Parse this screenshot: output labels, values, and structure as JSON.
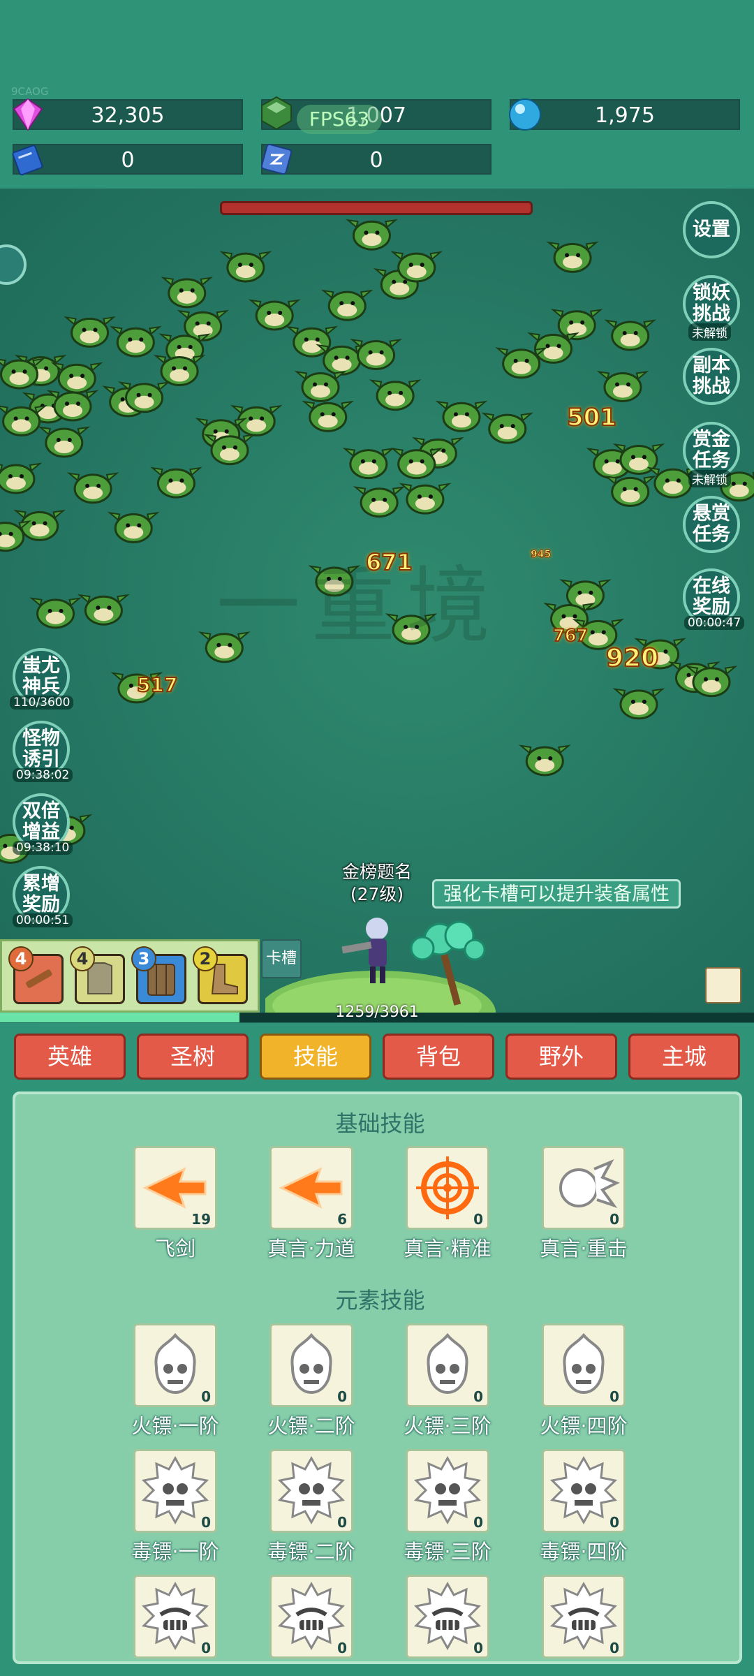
{
  "top": {
    "game_id": "9CAOG",
    "fps": "FPS63",
    "gems": "32,305",
    "green_crystal": "1,007",
    "blue_orb": "1,975",
    "book": "0",
    "rune": "0"
  },
  "battle": {
    "watermark": "一重境",
    "damage_numbers": [
      "501",
      "671",
      "517",
      "767",
      "920",
      "945"
    ],
    "hero_name": "金榜题名",
    "hero_level": "(27级)",
    "hint": "强化卡槽可以提升装备属性",
    "card_slot_label": "卡槽",
    "xp_text": "1259/3961",
    "xp_fraction": 0.318
  },
  "right_buttons": [
    {
      "label": "设置",
      "sub": ""
    },
    {
      "label": "锁妖挑战",
      "sub": "未解锁"
    },
    {
      "label": "副本挑战",
      "sub": ""
    },
    {
      "label": "赏金任务",
      "sub": "未解锁"
    },
    {
      "label": "悬赏任务",
      "sub": ""
    },
    {
      "label": "在线奖励",
      "sub": "00:00:47"
    }
  ],
  "left_buttons": [
    {
      "label": "蚩尤神兵",
      "sub": "110/3600"
    },
    {
      "label": "怪物诱引",
      "sub": "09:38:02"
    },
    {
      "label": "双倍增益",
      "sub": "09:38:10"
    },
    {
      "label": "累增奖励",
      "sub": "00:00:51"
    }
  ],
  "equipment": [
    {
      "num": "4",
      "item": "sword-icon"
    },
    {
      "num": "4",
      "item": "armor-icon"
    },
    {
      "num": "3",
      "item": "shield-icon"
    },
    {
      "num": "2",
      "item": "boots-icon"
    }
  ],
  "nav": [
    "英雄",
    "圣树",
    "技能",
    "背包",
    "野外",
    "主城"
  ],
  "nav_active": "技能",
  "basic_title": "基础技能",
  "basic_skills": [
    {
      "name": "飞剑",
      "count": "19"
    },
    {
      "name": "真言·力道",
      "count": "6"
    },
    {
      "name": "真言·精准",
      "count": "0"
    },
    {
      "name": "真言·重击",
      "count": "0"
    }
  ],
  "element_title": "元素技能",
  "fire_skills": [
    {
      "name": "火镖·一阶",
      "count": "0"
    },
    {
      "name": "火镖·二阶",
      "count": "0"
    },
    {
      "name": "火镖·三阶",
      "count": "0"
    },
    {
      "name": "火镖·四阶",
      "count": "0"
    }
  ],
  "poison_skills": [
    {
      "name": "毒镖·一阶",
      "count": "0"
    },
    {
      "name": "毒镖·二阶",
      "count": "0"
    },
    {
      "name": "毒镖·三阶",
      "count": "0"
    },
    {
      "name": "毒镖·四阶",
      "count": "0"
    }
  ],
  "grin_skills": [
    {
      "count": "0"
    },
    {
      "count": "0"
    },
    {
      "count": "0"
    },
    {
      "count": "0"
    }
  ],
  "colors": {
    "accent_active": "#f1b32a",
    "nav": "#e45a48",
    "panel": "#86ceaa"
  }
}
